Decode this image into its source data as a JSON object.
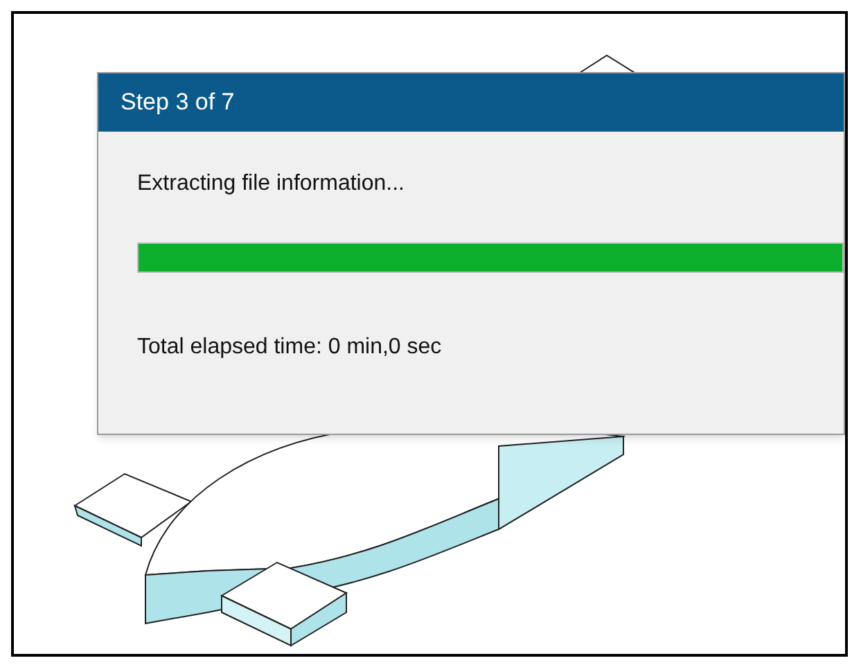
{
  "dialog": {
    "title": "Step 3 of 7",
    "message": "Extracting file information...",
    "progress": {
      "level": 1
    },
    "elapsed": "Total elapsed time: 0 min,0 sec"
  }
}
